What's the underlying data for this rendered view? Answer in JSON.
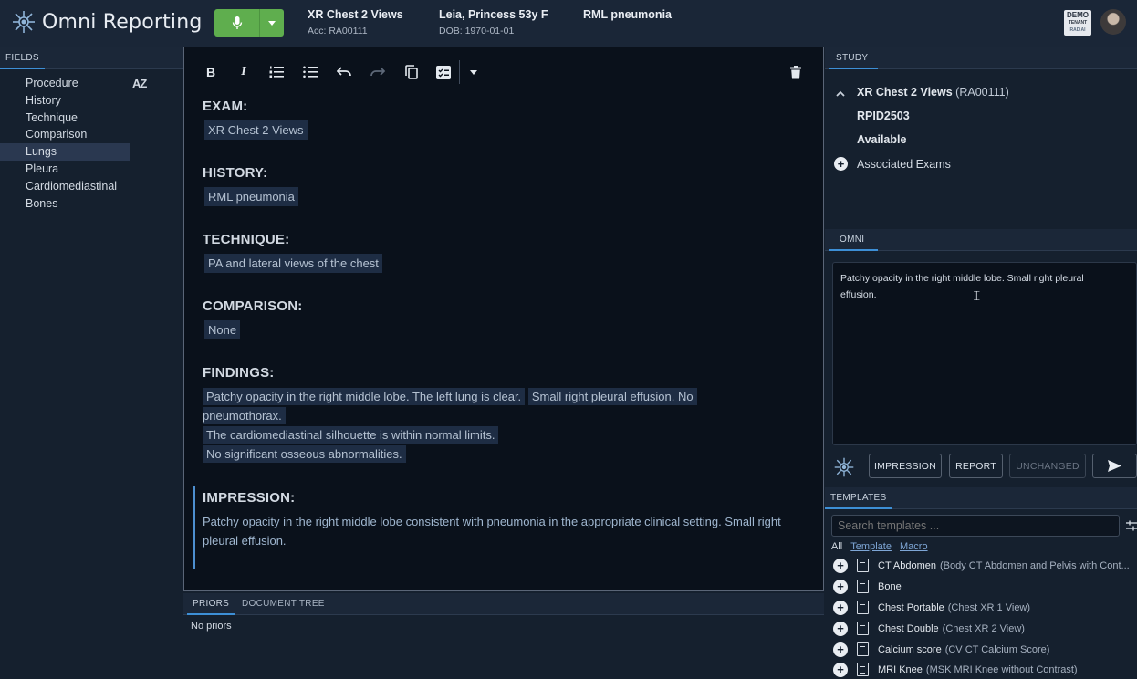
{
  "app": {
    "title": "Omni Reporting"
  },
  "header": {
    "exam": "XR Chest 2 Views",
    "acc": "Acc: RA00111",
    "patient": "Leia, Princess 53y F",
    "dob": "DOB: 1970-01-01",
    "indication": "RML pneumonia",
    "demo_line1": "DEMO",
    "demo_line2": "TENANT",
    "demo_line3": "RAD AI",
    "mic_color": "#5fae4e"
  },
  "fields": {
    "tab": "FIELDS",
    "sort_label": "AZ",
    "items": [
      "Procedure",
      "History",
      "Technique",
      "Comparison",
      "Lungs",
      "Pleura",
      "Cardiomediastinal",
      "Bones"
    ],
    "selected": "Lungs"
  },
  "editor": {
    "exam_h": "EXAM:",
    "exam_v": "XR Chest 2 Views",
    "history_h": "HISTORY:",
    "history_v": "RML pneumonia",
    "technique_h": "TECHNIQUE:",
    "technique_v": "PA and lateral views of the chest",
    "comparison_h": "COMPARISON:",
    "comparison_v": "None",
    "findings_h": "FINDINGS:",
    "findings_1a": "Patchy opacity in the right middle lobe. The left lung is clear.",
    "findings_1b": "Small right pleural effusion. No",
    "findings_1c": "pneumothorax.",
    "findings_2": "The cardiomediastinal silhouette is within normal limits.",
    "findings_3": "No significant osseous abnormalities.",
    "impression_h": "IMPRESSION:",
    "impression_v": "Patchy opacity in the right middle lobe consistent with pneumonia in the appropriate clinical setting. Small right pleural effusion."
  },
  "priors": {
    "tab1": "PRIORS",
    "tab2": "DOCUMENT TREE",
    "empty": "No priors"
  },
  "study": {
    "tab": "STUDY",
    "exam": "XR Chest 2 Views",
    "acc": "(RA00111)",
    "id": "RPID2503",
    "status": "Available",
    "associated": "Associated Exams"
  },
  "omni": {
    "tab": "OMNI",
    "text": "Patchy opacity in the right middle lobe. Small right pleural effusion.",
    "btn_impression": "IMPRESSION",
    "btn_report": "REPORT",
    "btn_unchanged": "UNCHANGED"
  },
  "templates": {
    "tab": "TEMPLATES",
    "search_placeholder": "Search templates ...",
    "filter_all": "All",
    "filter_template": "Template",
    "filter_macro": "Macro",
    "items": [
      {
        "name": "CT Abdomen",
        "sub": "(Body CT Abdomen and Pelvis with Cont..."
      },
      {
        "name": "Bone",
        "sub": ""
      },
      {
        "name": "Chest Portable",
        "sub": "(Chest XR 1 View)"
      },
      {
        "name": "Chest Double",
        "sub": "(Chest XR 2 View)"
      },
      {
        "name": "Calcium score",
        "sub": "(CV CT Calcium Score)"
      },
      {
        "name": "MRI Knee",
        "sub": "(MSK MRI Knee without Contrast)"
      }
    ]
  }
}
